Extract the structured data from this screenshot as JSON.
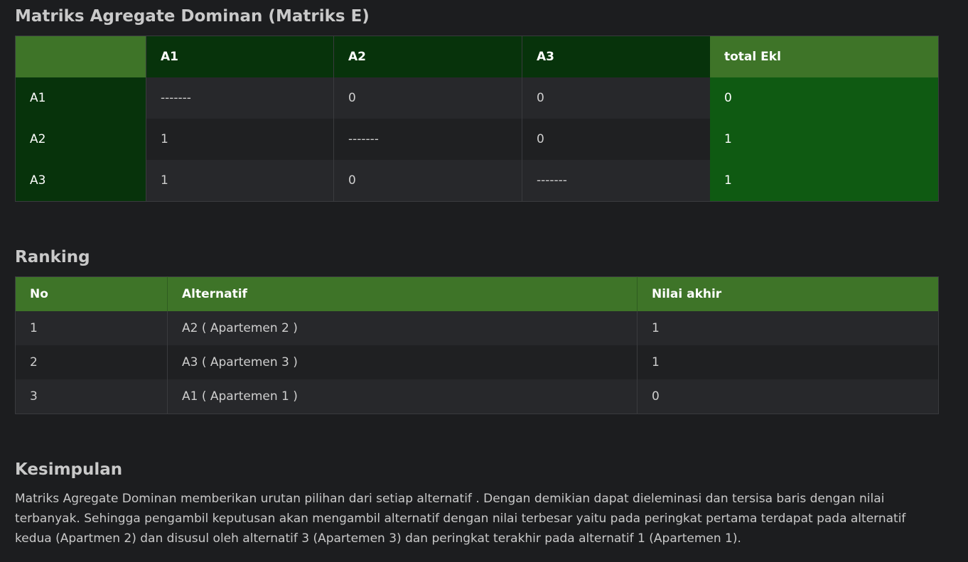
{
  "matrix": {
    "title": "Matriks Agregate Dominan (Matriks E)",
    "columns": [
      "",
      "A1",
      "A2",
      "A3",
      "total Ekl"
    ],
    "rows": [
      {
        "label": "A1",
        "cells": [
          "-------",
          "0",
          "0"
        ],
        "total": "0"
      },
      {
        "label": "A2",
        "cells": [
          "1",
          "-------",
          "0"
        ],
        "total": "1"
      },
      {
        "label": "A3",
        "cells": [
          "1",
          "0",
          "-------"
        ],
        "total": "1"
      }
    ]
  },
  "ranking": {
    "title": "Ranking",
    "columns": [
      "No",
      "Alternatif",
      "Nilai akhir"
    ],
    "rows": [
      [
        "1",
        "A2 ( Apartemen 2 )",
        "1"
      ],
      [
        "2",
        "A3 ( Apartemen 3 )",
        "1"
      ],
      [
        "3",
        "A1 ( Apartemen 1 )",
        "0"
      ]
    ]
  },
  "conclusion": {
    "title": "Kesimpulan",
    "text": "Matriks Agregate Dominan memberikan urutan pilihan dari setiap alternatif . Dengan demikian dapat dieleminasi dan tersisa baris dengan nilai terbanyak. Sehingga pengambil keputusan akan mengambil alternatif dengan nilai terbesar yaitu pada peringkat pertama terdapat pada alternatif kedua (Apartmen 2) dan disusul oleh alternatif 3 (Apartemen 3) dan peringkat terakhir pada alternatif 1 (Apartemen 1)."
  },
  "colors": {
    "background": "#1c1d1f",
    "header_green": "#3e7428",
    "dark_green": "#07330b",
    "total_green": "#0f5a12"
  }
}
